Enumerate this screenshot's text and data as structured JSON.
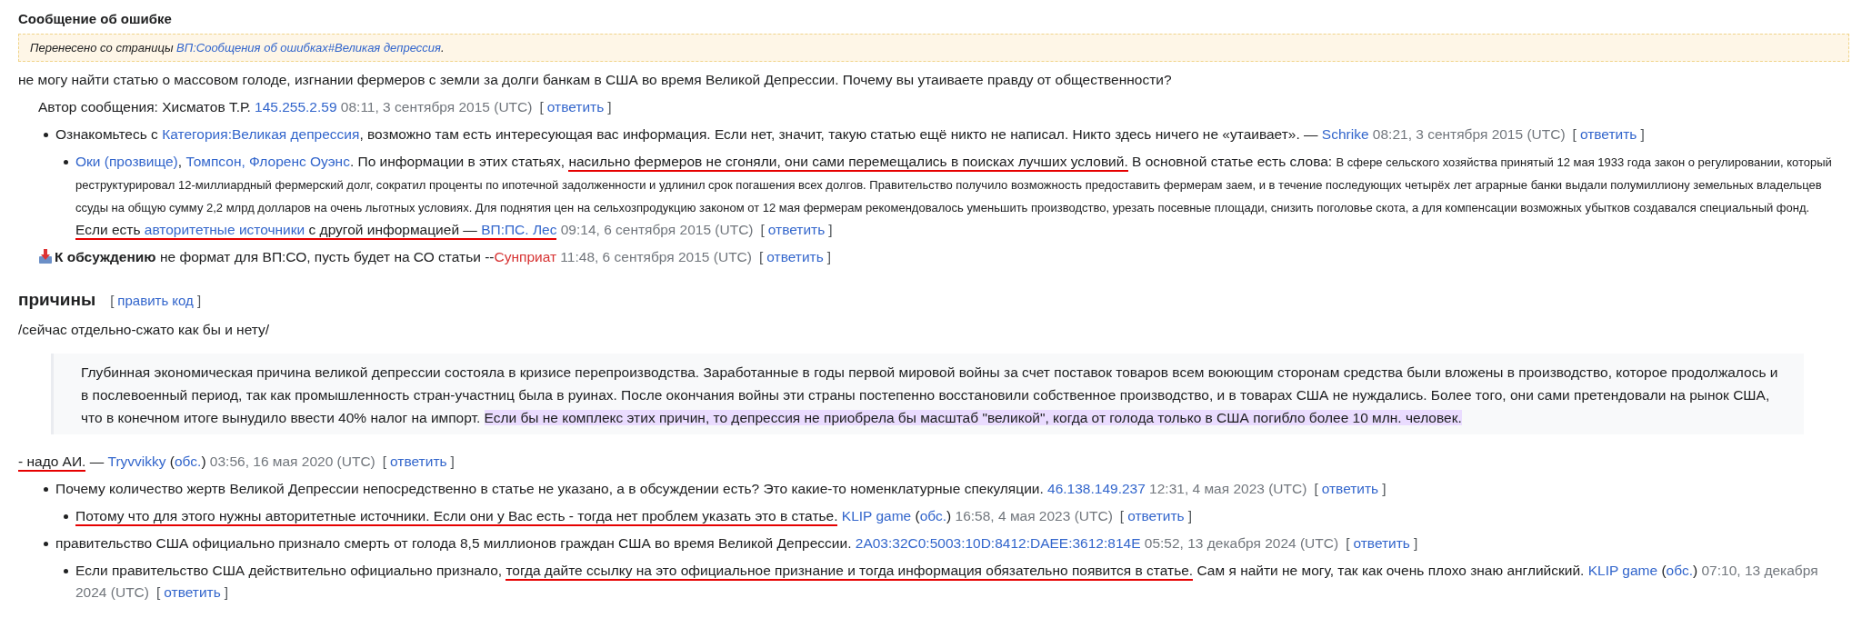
{
  "sections": [
    {
      "kind": "subheading",
      "title": "Сообщение об ошибке",
      "body": [
        {
          "kind": "banner",
          "segments": [
            {
              "kind": "text",
              "text": "Перенесено со страницы "
            },
            {
              "kind": "link",
              "text": "ВП:Сообщения об ошибках#Великая депрессия"
            },
            {
              "kind": "text",
              "text": "."
            }
          ]
        },
        {
          "kind": "comment",
          "bullet": false,
          "segments": [
            {
              "kind": "text",
              "text": "не могу найти статью о массовом голоде, изгнании фермеров с земли за долги банкам в США во время Великой Депрессии. Почему вы утаиваете правду от общественности?"
            }
          ],
          "children": [
            {
              "kind": "comment",
              "bullet": false,
              "segments": [
                {
                  "kind": "text",
                  "text": "Автор сообщения: Хисматов Т.Р. "
                },
                {
                  "kind": "link",
                  "text": "145.255.2.59"
                },
                {
                  "kind": "time",
                  "text": " 08:11, 3 сентября 2015 (UTC)"
                },
                {
                  "kind": "reply",
                  "open": "[",
                  "label": "ответить",
                  "close": "]"
                }
              ]
            },
            {
              "kind": "comment",
              "bullet": true,
              "segments": [
                {
                  "kind": "text",
                  "text": "Ознакомьтесь с "
                },
                {
                  "kind": "link",
                  "text": "Категория:Великая депрессия"
                },
                {
                  "kind": "text",
                  "text": ", возможно там есть интересующая вас информация. Если нет, значит, такую статью ещё никто не написал. Никто здесь ничего не «утаивает». — "
                },
                {
                  "kind": "link",
                  "text": "Schrike"
                },
                {
                  "kind": "time",
                  "text": " 08:21, 3 сентября 2015 (UTC)"
                },
                {
                  "kind": "reply",
                  "open": "[",
                  "label": "ответить",
                  "close": "]"
                }
              ],
              "children": [
                {
                  "kind": "comment",
                  "bullet": true,
                  "segments": [
                    {
                      "kind": "link",
                      "text": "Оки (прозвище)"
                    },
                    {
                      "kind": "text",
                      "text": ", "
                    },
                    {
                      "kind": "link",
                      "text": "Томпсон, Флоренс Оуэнс"
                    },
                    {
                      "kind": "text",
                      "text": ". По информации в этих статьях, "
                    },
                    {
                      "kind": "text",
                      "text": "насильно фермеров не сгоняли, они сами перемещались в поисках лучших условий.",
                      "underlined": true
                    },
                    {
                      "kind": "text",
                      "text": " В основной статье есть слова: "
                    },
                    {
                      "kind": "small",
                      "text": "В сфере сельского хозяйства принятый 12 мая 1933 года закон о регулировании, который реструктурировал 12-миллиардный фермерский долг, сократил проценты по ипотечной задолженности и удлинил срок погашения всех долгов. Правительство получило возможность предоставить фермерам заем, и в течение последующих четырёх лет аграрные банки выдали полумиллиону земельных владельцев ссуды на общую сумму 2,2 млрд долларов на очень льготных условиях. Для поднятия цен на сельхозпродукцию законом от 12 мая фермерам рекомендовалось уменьшить производство, урезать посевные площади, снизить поголовье скота, а для компенсации возможных убытков создавался специальный фонд."
                    },
                    {
                      "kind": "break"
                    },
                    {
                      "kind": "text",
                      "text": "Если есть ",
                      "underlined": true
                    },
                    {
                      "kind": "link",
                      "text": "авторитетные источники",
                      "underlined": true
                    },
                    {
                      "kind": "text",
                      "text": " с другой информацией — ",
                      "underlined": true
                    },
                    {
                      "kind": "link",
                      "text": "ВП:ПС. Лес",
                      "underlined": true
                    },
                    {
                      "kind": "time",
                      "text": " 09:14, 6 сентября 2015 (UTC)"
                    },
                    {
                      "kind": "reply",
                      "open": "[",
                      "label": "ответить",
                      "close": "]"
                    }
                  ]
                }
              ]
            },
            {
              "kind": "moved",
              "bullet": false,
              "segments": [
                {
                  "kind": "bold",
                  "text": "К обсуждению"
                },
                {
                  "kind": "text",
                  "text": " не формат для ВП:СО, пусть будет на СО статьи --"
                },
                {
                  "kind": "redlink",
                  "text": "Сунприат"
                },
                {
                  "kind": "time",
                  "text": " 11:48, 6 сентября 2015 (UTC)"
                },
                {
                  "kind": "reply",
                  "open": "[",
                  "label": "ответить",
                  "close": "]"
                }
              ]
            }
          ]
        }
      ]
    },
    {
      "kind": "heading",
      "title": "причины",
      "edit": {
        "open": "[",
        "label": "править код",
        "close": "]"
      },
      "body": [
        {
          "kind": "comment",
          "bullet": false,
          "segments": [
            {
              "kind": "text",
              "text": "/сейчас отдельно-сжато как бы и нету/"
            }
          ]
        },
        {
          "kind": "quote",
          "segments": [
            {
              "kind": "text",
              "text": "Глубинная экономическая причина великой депрессии состояла в кризисе перепроизводства. Заработанные в годы первой мировой войны за счет поставок товаров всем воюющим сторонам средства были вложены в производство, которое продолжалось и в послевоенный период, так как промышленность стран-участниц была в руинах. После окончания войны эти страны постепенно восстановили собственное производство, и в товарах США не нуждались. Более того, они сами претендовали на рынок США, что в конечном итоге вынудило ввести 40% налог на импорт. "
            },
            {
              "kind": "text",
              "text": "Если бы не комплекс этих причин, то депрессия не приобрела бы масштаб \"великой\", когда от голода только в США погибло более 10 млн. человек.",
              "highlighted": true
            }
          ]
        },
        {
          "kind": "comment",
          "bullet": false,
          "segments": [
            {
              "kind": "text",
              "text": "- надо АИ.",
              "underlined": true
            },
            {
              "kind": "text",
              "text": " — "
            },
            {
              "kind": "link",
              "text": "Tryvvikky"
            },
            {
              "kind": "text",
              "text": " ("
            },
            {
              "kind": "link",
              "text": "обс."
            },
            {
              "kind": "text",
              "text": ")"
            },
            {
              "kind": "time",
              "text": " 03:56, 16 мая 2020 (UTC)"
            },
            {
              "kind": "reply",
              "open": "[",
              "label": "ответить",
              "close": "]"
            }
          ],
          "children": [
            {
              "kind": "comment",
              "bullet": true,
              "segments": [
                {
                  "kind": "text",
                  "text": "Почему количество жертв Великой Депрессии непосредственно в статье не указано, а в обсуждении есть? Это какие-то номенклатурные спекуляции. "
                },
                {
                  "kind": "link",
                  "text": "46.138.149.237"
                },
                {
                  "kind": "time",
                  "text": " 12:31, 4 мая 2023 (UTC)"
                },
                {
                  "kind": "reply",
                  "open": "[",
                  "label": "ответить",
                  "close": "]"
                }
              ],
              "children": [
                {
                  "kind": "comment",
                  "bullet": true,
                  "segments": [
                    {
                      "kind": "text",
                      "text": "Потому что для этого нужны авторитетные источники. Если они у Вас есть - тогда нет проблем указать это в статье.",
                      "underlined": true
                    },
                    {
                      "kind": "link",
                      "text": "KLIP game",
                      "gap": true
                    },
                    {
                      "kind": "text",
                      "text": " ("
                    },
                    {
                      "kind": "link",
                      "text": "обс."
                    },
                    {
                      "kind": "text",
                      "text": ")"
                    },
                    {
                      "kind": "time",
                      "text": " 16:58, 4 мая 2023 (UTC)"
                    },
                    {
                      "kind": "reply",
                      "open": "[",
                      "label": "ответить",
                      "close": "]"
                    }
                  ]
                }
              ]
            },
            {
              "kind": "comment",
              "bullet": true,
              "segments": [
                {
                  "kind": "text",
                  "text": "правительство США официально признало смерть от голода 8,5 миллионов граждан США во время Великой Депрессии. "
                },
                {
                  "kind": "link",
                  "text": "2A03:32C0:5003:10D:8412:DAEE:3612:814E"
                },
                {
                  "kind": "time",
                  "text": " 05:52, 13 декабря 2024 (UTC)"
                },
                {
                  "kind": "reply",
                  "open": "[",
                  "label": "ответить",
                  "close": "]"
                }
              ],
              "children": [
                {
                  "kind": "comment",
                  "bullet": true,
                  "segments": [
                    {
                      "kind": "text",
                      "text": "Если правительство США действительно официально признало, "
                    },
                    {
                      "kind": "text",
                      "text": "тогда дайте ссылку на это официальное признание и тогда информация обязательно появится в статье.",
                      "underlined": true
                    },
                    {
                      "kind": "text",
                      "text": " Сам я найти не могу, так как очень плохо знаю английский. "
                    },
                    {
                      "kind": "link",
                      "text": "KLIP game"
                    },
                    {
                      "kind": "text",
                      "text": " ("
                    },
                    {
                      "kind": "link",
                      "text": "обс."
                    },
                    {
                      "kind": "text",
                      "text": ")"
                    },
                    {
                      "kind": "time",
                      "text": " 07:10, 13 декабря 2024 (UTC)"
                    },
                    {
                      "kind": "reply",
                      "open": "[",
                      "label": "ответить",
                      "close": "]"
                    }
                  ]
                }
              ]
            }
          ]
        }
      ]
    }
  ]
}
